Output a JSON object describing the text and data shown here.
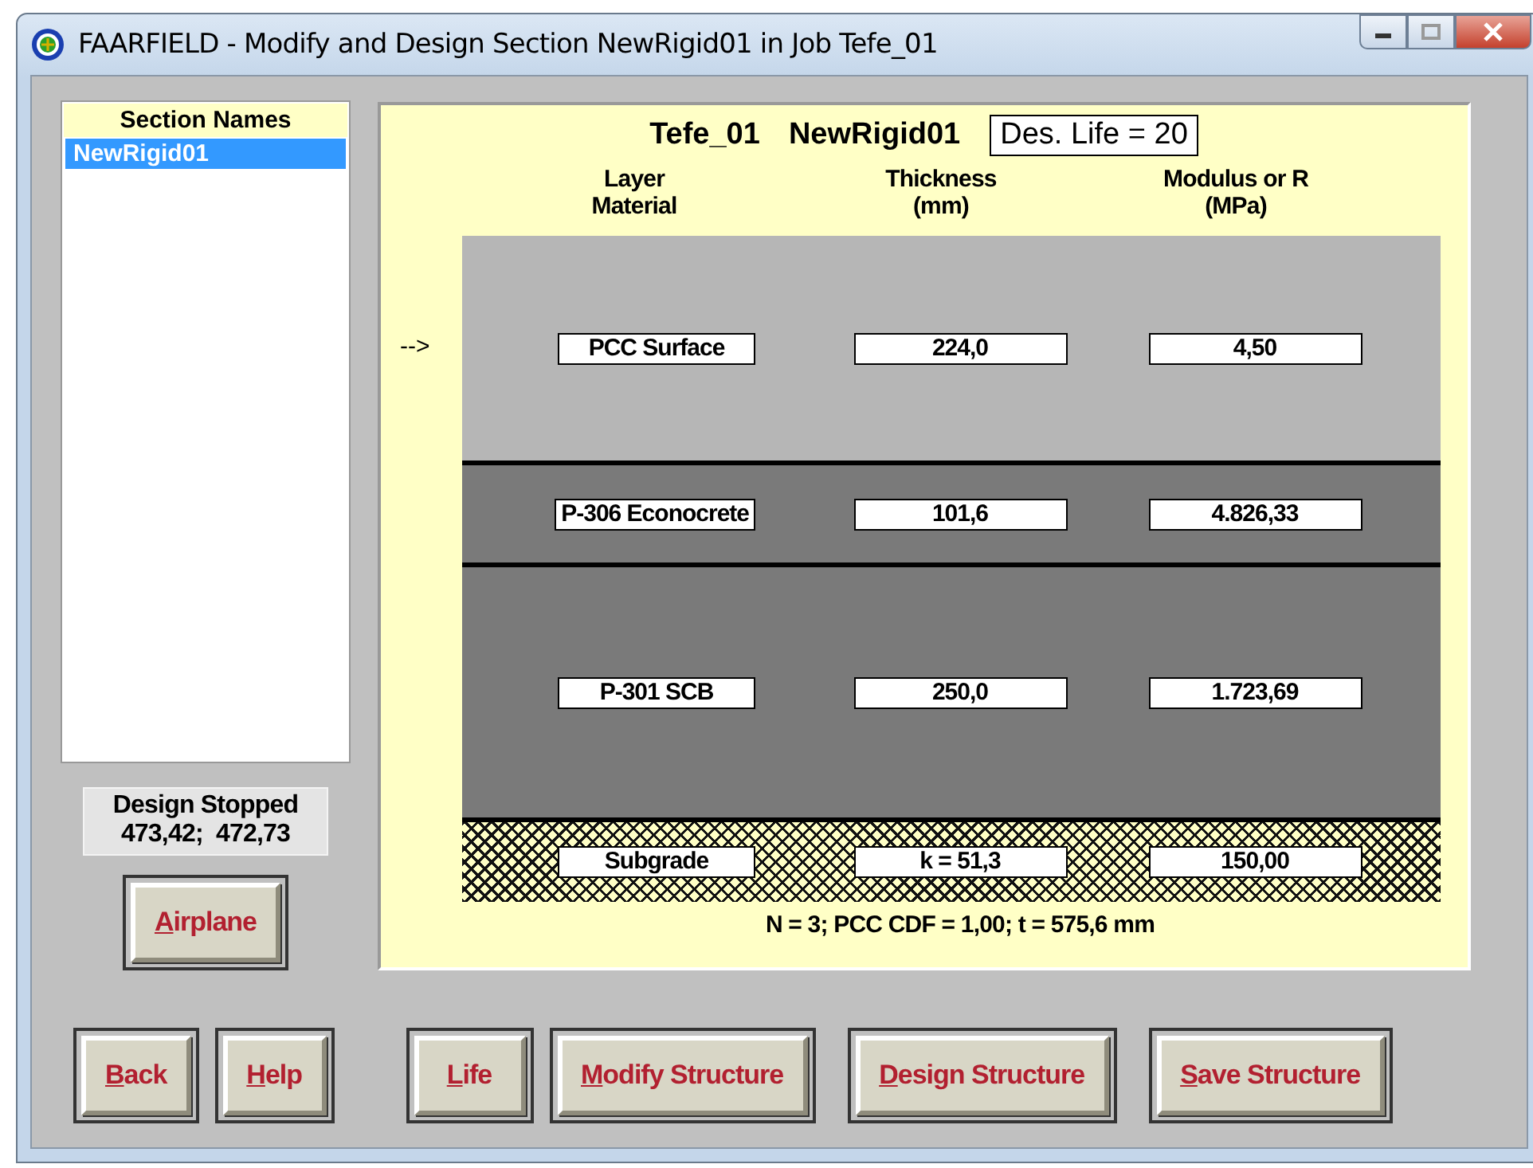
{
  "window": {
    "title": "FAARFIELD - Modify and Design Section NewRigid01 in Job Tefe_01"
  },
  "section_list": {
    "heading": "Section Names",
    "items": [
      {
        "label": "NewRigid01",
        "selected": true
      }
    ]
  },
  "status": {
    "line_1": "Design Stopped",
    "line_2": "473,42;  472,73"
  },
  "structure": {
    "job": "Tefe_01",
    "section": "NewRigid01",
    "design_life": "Des. Life = 20",
    "columns": [
      "Layer\nMaterial",
      "Thickness\n(mm)",
      "Modulus or R\n(MPa)"
    ],
    "layers": [
      {
        "kind": "surface",
        "pointer": "-->",
        "material": "PCC Surface",
        "thickness": "224,0",
        "modulus": "4,50"
      },
      {
        "kind": "stabilized",
        "material": "P-306 Econocrete",
        "thickness": "101,6",
        "modulus": "4.826,33"
      },
      {
        "kind": "base",
        "material": "P-301 SCB",
        "thickness": "250,0",
        "modulus": "1.723,69"
      },
      {
        "kind": "subgrade",
        "material": "Subgrade",
        "thickness": "k = 51,3",
        "modulus": "150,00"
      }
    ],
    "summary": "N = 3;  PCC CDF = 1,00;  t = 575,6 mm"
  },
  "side_buttons": [
    {
      "label": "Airplane",
      "underlined": true
    }
  ],
  "bottom_buttons": [
    {
      "label": "Back",
      "underlined": true
    },
    {
      "label": "Help",
      "underlined": true
    },
    {
      "label": "Life",
      "underlined": true
    },
    {
      "label": "Modify Structure",
      "underlined": true
    },
    {
      "label": "Design Structure",
      "underlined": true
    },
    {
      "label": "Save Structure",
      "underlined": true
    }
  ]
}
